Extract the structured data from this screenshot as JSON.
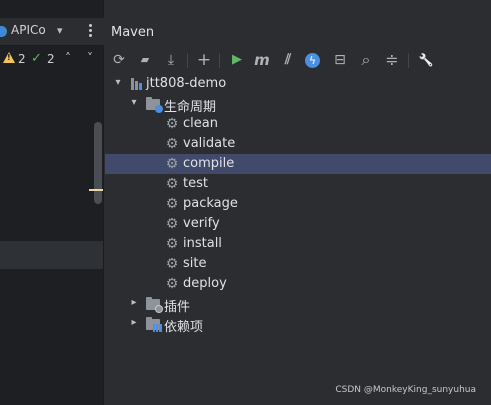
{
  "editor": {
    "tab_label": "APICo",
    "warnings_count": "2",
    "ok_count": "2"
  },
  "maven": {
    "title": "Maven",
    "toolbar": [
      {
        "name": "reload-icon",
        "glyph": "⟳"
      },
      {
        "name": "add-folder-icon",
        "glyph": "▰"
      },
      {
        "name": "download-icon",
        "glyph": "⤓"
      },
      {
        "name": "add-icon",
        "glyph": "+"
      },
      {
        "name": "run-icon",
        "glyph": "▶"
      },
      {
        "name": "execute-goal-icon",
        "glyph": "m"
      },
      {
        "name": "toggle-offline-icon",
        "glyph": "⫽"
      },
      {
        "name": "skip-tests-icon",
        "glyph": "ϟ"
      },
      {
        "name": "show-dependencies-icon",
        "glyph": "⊟"
      },
      {
        "name": "find-icon",
        "glyph": "⌕"
      },
      {
        "name": "collapse-all-icon",
        "glyph": "≑"
      },
      {
        "name": "settings-wrench-icon",
        "glyph": "🔧"
      }
    ],
    "tree": {
      "project": "jtt808-demo",
      "lifecycle": "生命周期",
      "goals": [
        "clean",
        "validate",
        "compile",
        "test",
        "package",
        "verify",
        "install",
        "site",
        "deploy"
      ],
      "selected_goal": "compile",
      "plugins": "插件",
      "dependencies": "依赖项"
    }
  },
  "watermark": "CSDN @MonkeyKing_sunyuhua",
  "colors": {
    "background": "#2b2d30",
    "editor_bg": "#1e1f22",
    "selection": "#424a6b",
    "accent_blue": "#4a8fe0",
    "run_green": "#5fb865",
    "warning_yellow": "#f2c55c"
  }
}
